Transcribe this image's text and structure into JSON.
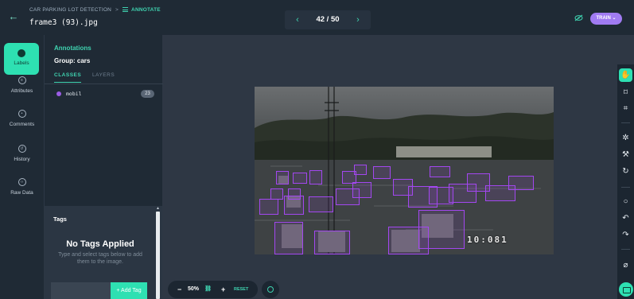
{
  "header": {
    "project": "CAR PARKING LOT DETECTION",
    "separator": ">",
    "mode": "ANNOTATE",
    "filename": "frame3 (93).jpg",
    "pager": "42 / 50",
    "train_label": "TRAIN",
    "icons": {
      "back": "arrow-left-icon",
      "prev": "chevron-left-icon",
      "next": "chevron-right-icon",
      "visibility": "eye-off-icon"
    }
  },
  "rail": {
    "items": [
      {
        "label": "Labels",
        "icon": "tag-icon",
        "active": true
      },
      {
        "label": "Attributes",
        "icon": "list-icon"
      },
      {
        "label": "Comments",
        "icon": "comment-icon"
      },
      {
        "label": "History",
        "icon": "history-icon"
      },
      {
        "label": "Raw Data",
        "icon": "code-icon"
      }
    ]
  },
  "annotations": {
    "title": "Annotations",
    "group": "Group: cars",
    "tabs": [
      "CLASSES",
      "LAYERS"
    ],
    "classes": [
      {
        "name": "mobil",
        "count": "23",
        "color": "#9b5de5"
      }
    ]
  },
  "tags": {
    "title": "Tags",
    "empty_title": "No Tags Applied",
    "empty_hint": "Type and select tags below to add them to the image.",
    "input_value": "",
    "add_label": "+ Add Tag"
  },
  "canvas": {
    "timestamp": "10:081",
    "box_color": "#a347f0",
    "box_count": 23
  },
  "zoom": {
    "level": "50%",
    "minus": "−",
    "plus": "+",
    "reset": "RESET"
  },
  "toolbar": {
    "tools": [
      "hand-icon",
      "bounding-box-icon",
      "polygon-icon",
      "magic-wand-icon",
      "smart-select-icon",
      "repeat-icon",
      "comment-icon",
      "undo-icon",
      "redo-icon",
      "clear-icon",
      "chat-icon"
    ]
  }
}
